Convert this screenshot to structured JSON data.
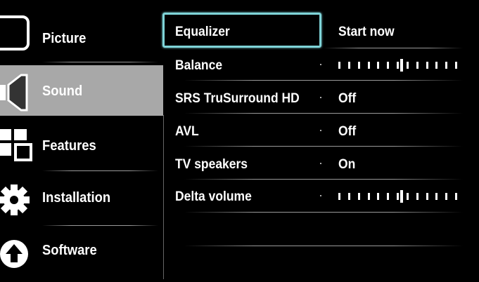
{
  "left_menu": [
    {
      "label": "Picture",
      "icon": "picture-icon",
      "selected": false
    },
    {
      "label": "Sound",
      "icon": "speaker-icon",
      "selected": true
    },
    {
      "label": "Features",
      "icon": "features-icon",
      "selected": false
    },
    {
      "label": "Installation",
      "icon": "gear-icon",
      "selected": false
    },
    {
      "label": "Software",
      "icon": "upload-arrow-icon",
      "selected": false
    }
  ],
  "settings": [
    {
      "label": "Equalizer",
      "value": "Start now",
      "focused": true
    },
    {
      "label": "Balance",
      "slider": {
        "ticks": 13,
        "position": 0.5
      }
    },
    {
      "label": "SRS TruSurround HD",
      "value": "Off"
    },
    {
      "label": "AVL",
      "value": "Off"
    },
    {
      "label": "TV speakers",
      "value": "On"
    },
    {
      "label": "Delta volume",
      "slider": {
        "ticks": 13,
        "position": 0.5
      }
    }
  ],
  "colors": {
    "background": "#000000",
    "selected_bg": "#a8a8a8",
    "focus_border": "#7fd4d8",
    "text": "#ffffff"
  }
}
